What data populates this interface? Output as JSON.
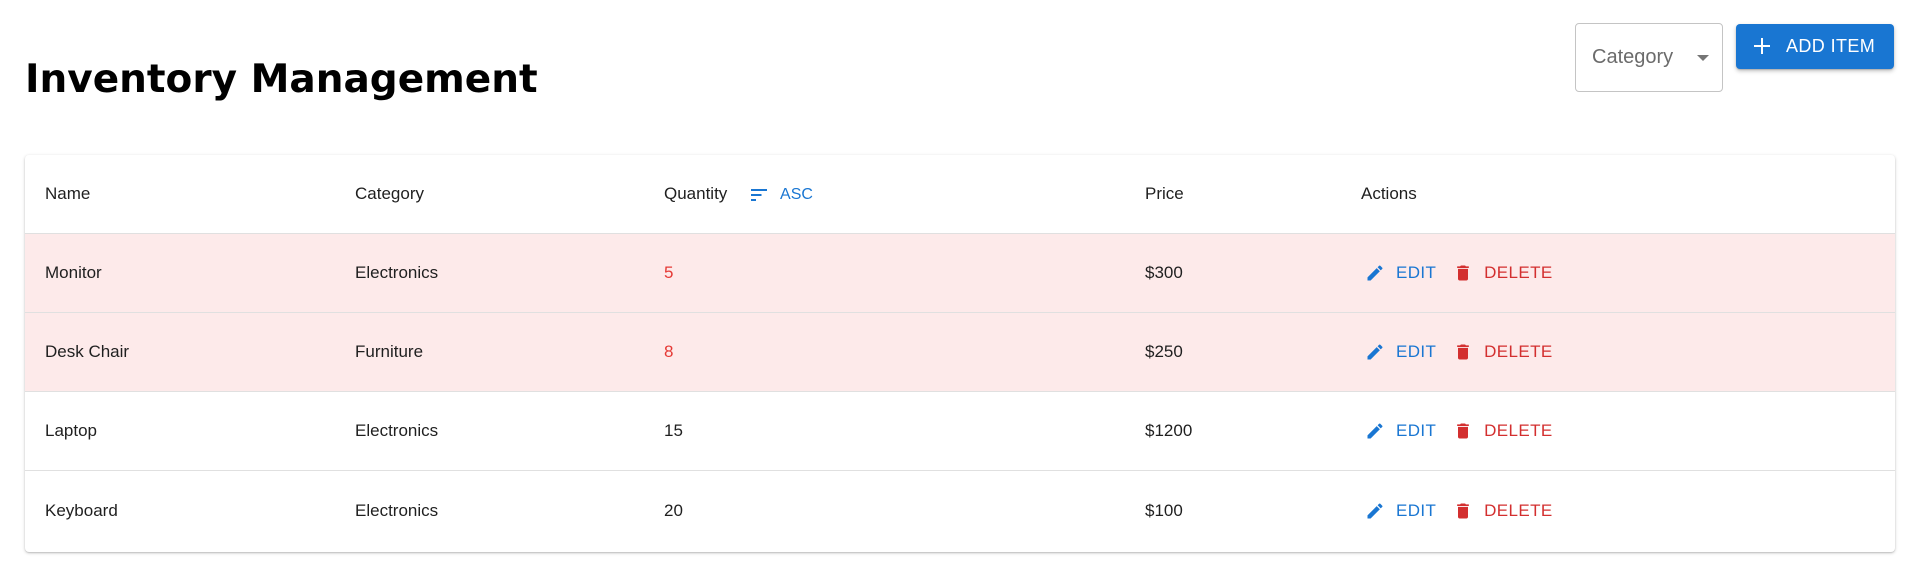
{
  "header": {
    "title": "Inventory Management"
  },
  "toolbar": {
    "category_select": {
      "label": "Category",
      "icon": "arrow-drop-down-icon"
    },
    "add_button": {
      "label": "ADD ITEM",
      "icon": "plus-icon"
    }
  },
  "table": {
    "columns": [
      "Name",
      "Category",
      "Quantity",
      "Price",
      "Actions"
    ],
    "sort": {
      "label": "ASC",
      "icon": "sort-icon"
    },
    "rows": [
      {
        "name": "Monitor",
        "category": "Electronics",
        "quantity": "5",
        "price": "$300",
        "low_stock": true
      },
      {
        "name": "Desk Chair",
        "category": "Furniture",
        "quantity": "8",
        "price": "$250",
        "low_stock": true
      },
      {
        "name": "Laptop",
        "category": "Electronics",
        "quantity": "15",
        "price": "$1200",
        "low_stock": false
      },
      {
        "name": "Keyboard",
        "category": "Electronics",
        "quantity": "20",
        "price": "$100",
        "low_stock": false
      }
    ],
    "actions": {
      "edit_label": "EDIT",
      "edit_icon": "pencil-icon",
      "delete_label": "DELETE",
      "delete_icon": "trash-icon"
    }
  },
  "colors": {
    "primary": "#1976d2",
    "danger": "#d32f2f",
    "low_stock_row_bg": "#fdeaea",
    "low_stock_text": "#e53935"
  }
}
